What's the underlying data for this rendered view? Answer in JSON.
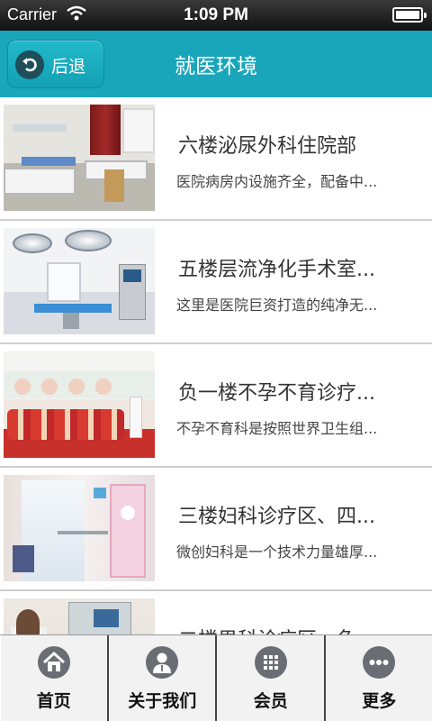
{
  "status_bar": {
    "carrier": "Carrier",
    "time": "1:09 PM"
  },
  "header": {
    "back_label": "后退",
    "title": "就医环境"
  },
  "list": {
    "items": [
      {
        "title": "六楼泌尿外科住院部",
        "description": "医院病房内设施齐全，配备中...",
        "image": "ward-photo"
      },
      {
        "title": "五楼层流净化手术室...",
        "description": "这里是医院巨资打造的纯净无...",
        "image": "operating-room-photo"
      },
      {
        "title": "负一楼不孕不育诊疗...",
        "description": "不孕不育科是按照世界卫生组...",
        "image": "clinic-photo"
      },
      {
        "title": "三楼妇科诊疗区、四...",
        "description": "微创妇科是一个技术力量雄厚...",
        "image": "hallway-photo"
      },
      {
        "title": "二楼男科诊疗区、鱼...",
        "description": "",
        "image": "exam-room-photo"
      }
    ]
  },
  "tab_bar": {
    "tabs": [
      {
        "label": "首页",
        "icon": "home-icon"
      },
      {
        "label": "关于我们",
        "icon": "person-icon"
      },
      {
        "label": "会员",
        "icon": "grid-icon"
      },
      {
        "label": "更多",
        "icon": "more-icon"
      }
    ]
  },
  "colors": {
    "nav_background": "#1aa6ba",
    "tab_icon": "#6a6e74"
  }
}
